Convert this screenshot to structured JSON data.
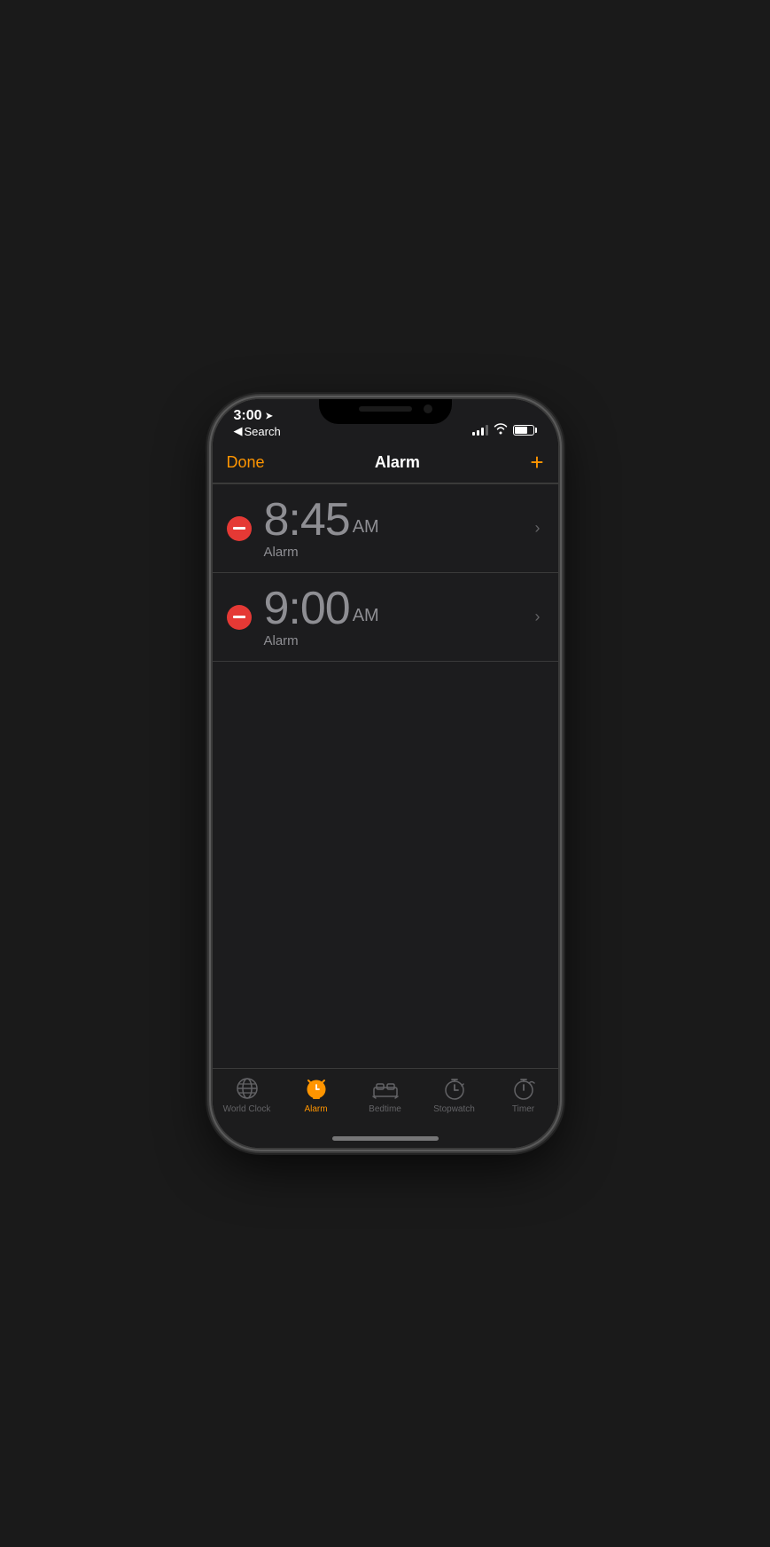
{
  "statusBar": {
    "time": "3:00",
    "backLabel": "Search",
    "signalBars": [
      4,
      6,
      8,
      10,
      12
    ],
    "batteryPercent": 70
  },
  "navBar": {
    "doneLabel": "Done",
    "title": "Alarm",
    "addLabel": "+"
  },
  "alarms": [
    {
      "time": "8:45",
      "ampm": "AM",
      "label": "Alarm"
    },
    {
      "time": "9:00",
      "ampm": "AM",
      "label": "Alarm"
    }
  ],
  "tabBar": {
    "items": [
      {
        "id": "world-clock",
        "label": "World Clock",
        "active": false
      },
      {
        "id": "alarm",
        "label": "Alarm",
        "active": true
      },
      {
        "id": "bedtime",
        "label": "Bedtime",
        "active": false
      },
      {
        "id": "stopwatch",
        "label": "Stopwatch",
        "active": false
      },
      {
        "id": "timer",
        "label": "Timer",
        "active": false
      }
    ]
  }
}
